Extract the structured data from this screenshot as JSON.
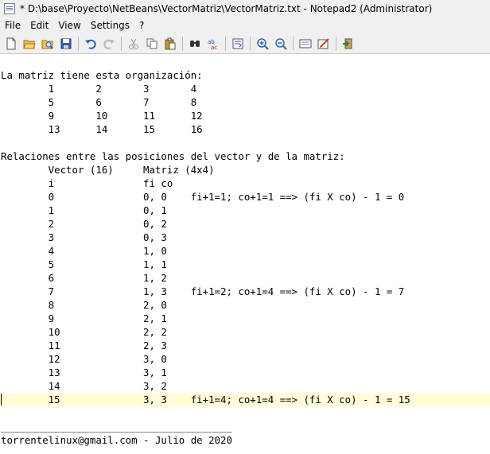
{
  "window": {
    "title": "* D:\\base\\Proyecto\\NetBeans\\VectorMatriz\\VectorMatriz.txt - Notepad2 (Administrator)"
  },
  "menu": {
    "items": [
      "File",
      "Edit",
      "View",
      "Settings",
      "?"
    ]
  },
  "toolbar": {
    "buttons": [
      "new-icon",
      "open-icon",
      "browse-icon",
      "save-icon",
      "undo-icon",
      "redo-icon",
      "cut-icon",
      "copy-icon",
      "paste-icon",
      "find-icon",
      "replace-icon",
      "word-wrap-icon",
      "zoom-in-icon",
      "zoom-out-icon",
      "select-scheme-icon",
      "customize-scheme-icon",
      "exit-icon"
    ]
  },
  "editor": {
    "current_line": 24,
    "lines": [
      "La matriz tiene esta organización:",
      "        1       2       3       4",
      "        5       6       7       8",
      "        9       10      11      12",
      "        13      14      15      16",
      "",
      "Relaciones entre las posiciones del vector y de la matriz:",
      "        Vector (16)     Matriz (4x4)",
      "        i               fi co",
      "        0               0, 0    fi+1=1; co+1=1 ==> (fi X co) - 1 = 0",
      "        1               0, 1",
      "        2               0, 2",
      "        3               0, 3",
      "        4               1, 0",
      "        5               1, 1",
      "        6               1, 2",
      "        7               1, 3    fi+1=2; co+1=4 ==> (fi X co) - 1 = 7",
      "        8               2, 0",
      "        9               2, 1",
      "        10              2, 2",
      "        11              2, 3",
      "        12              3, 0",
      "        13              3, 1",
      "        14              3, 2",
      "        15              3, 3    fi+1=4; co+1=4 ==> (fi X co) - 1 = 15",
      "",
      "_______________________________________",
      "torrentelinux@gmail.com - Julio de 2020"
    ]
  }
}
